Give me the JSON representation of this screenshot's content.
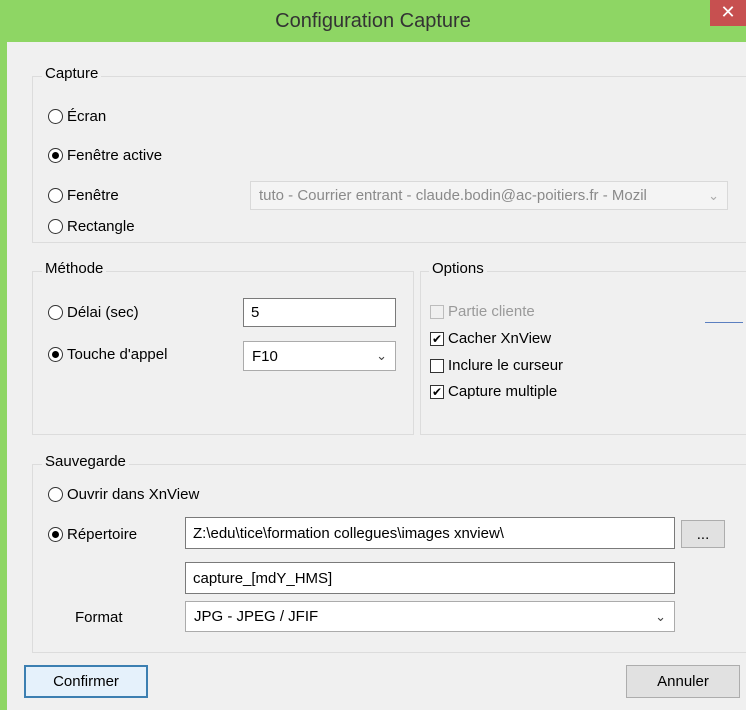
{
  "window": {
    "title": "Configuration Capture",
    "close_glyph": "✕"
  },
  "capture": {
    "label": "Capture",
    "options": [
      {
        "label": "Écran",
        "selected": false
      },
      {
        "label": "Fenêtre active",
        "selected": true
      },
      {
        "label": "Fenêtre",
        "selected": false
      },
      {
        "label": "Rectangle",
        "selected": false
      }
    ],
    "window_select": {
      "value": "tuto - Courrier entrant - claude.bodin@ac-poitiers.fr - Mozil",
      "enabled": false
    }
  },
  "methode": {
    "label": "Méthode",
    "delay_label": "Délai (sec)",
    "delay_selected": false,
    "delay_value": "5",
    "hotkey_label": "Touche d'appel",
    "hotkey_selected": true,
    "hotkey_value": "F10"
  },
  "options": {
    "label": "Options",
    "items": [
      {
        "label": "Partie cliente",
        "checked": false,
        "enabled": false
      },
      {
        "label": "Cacher XnView",
        "checked": true,
        "enabled": true
      },
      {
        "label": "Inclure le curseur",
        "checked": false,
        "enabled": true
      },
      {
        "label": "Capture multiple",
        "checked": true,
        "enabled": true
      }
    ]
  },
  "sauvegarde": {
    "label": "Sauvegarde",
    "open_label": "Ouvrir dans XnView",
    "open_selected": false,
    "dir_label": "Répertoire",
    "dir_selected": true,
    "dir_value": "Z:\\edu\\tice\\formation collegues\\images xnview\\",
    "browse_label": "...",
    "filename_value": "capture_[mdY_HMS]",
    "format_label": "Format",
    "format_value": "JPG - JPEG / JFIF"
  },
  "buttons": {
    "confirm": "Confirmer",
    "cancel": "Annuler"
  },
  "icons": {
    "check": "✔",
    "chevron": "⌄"
  }
}
